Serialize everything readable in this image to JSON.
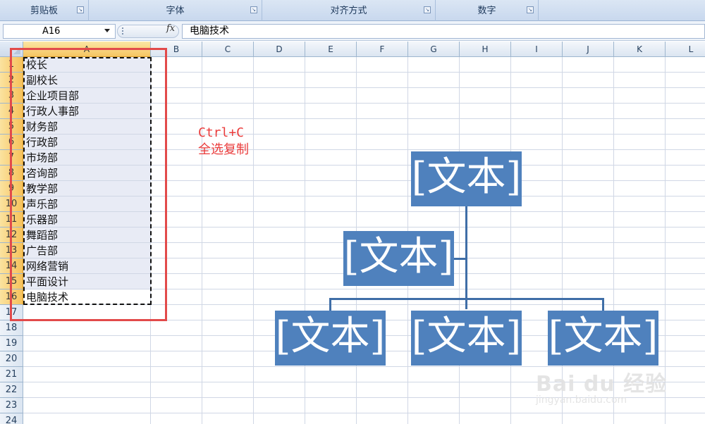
{
  "ribbon": {
    "groups": [
      {
        "label": "剪贴板"
      },
      {
        "label": "字体"
      },
      {
        "label": "对齐方式"
      },
      {
        "label": "数字"
      }
    ]
  },
  "formula_bar": {
    "name_box": "A16",
    "fx_symbol": "fx",
    "formula": "电脑技术"
  },
  "sheet": {
    "columns": [
      "A",
      "B",
      "C",
      "D",
      "E",
      "F",
      "G",
      "H",
      "I",
      "J",
      "K",
      "L"
    ],
    "rows": [
      "1",
      "2",
      "3",
      "4",
      "5",
      "6",
      "7",
      "8",
      "9",
      "10",
      "11",
      "12",
      "13",
      "14",
      "15",
      "16",
      "17",
      "18",
      "19",
      "20",
      "21",
      "22",
      "23",
      "24"
    ],
    "column_a": [
      "校长",
      "副校长",
      "企业项目部",
      "行政人事部",
      "财务部",
      "行政部",
      "市场部",
      "咨询部",
      "教学部",
      "声乐部",
      "乐器部",
      "舞蹈部",
      "广告部",
      "网络营销",
      "平面设计",
      "电脑技术"
    ],
    "selected_column": "A",
    "selected_rows": "1-16"
  },
  "annotation": {
    "line1": "Ctrl+C",
    "line2": "全选复制",
    "color": "#ea3b3b"
  },
  "smartart": {
    "fill_color": "#4f81bd",
    "boxes": [
      "[文本]",
      "[文本]",
      "[文本]",
      "[文本]",
      "[文本]"
    ]
  },
  "watermark": {
    "brand": "Bai du 经验",
    "url": "jingyan.baidu.com"
  }
}
